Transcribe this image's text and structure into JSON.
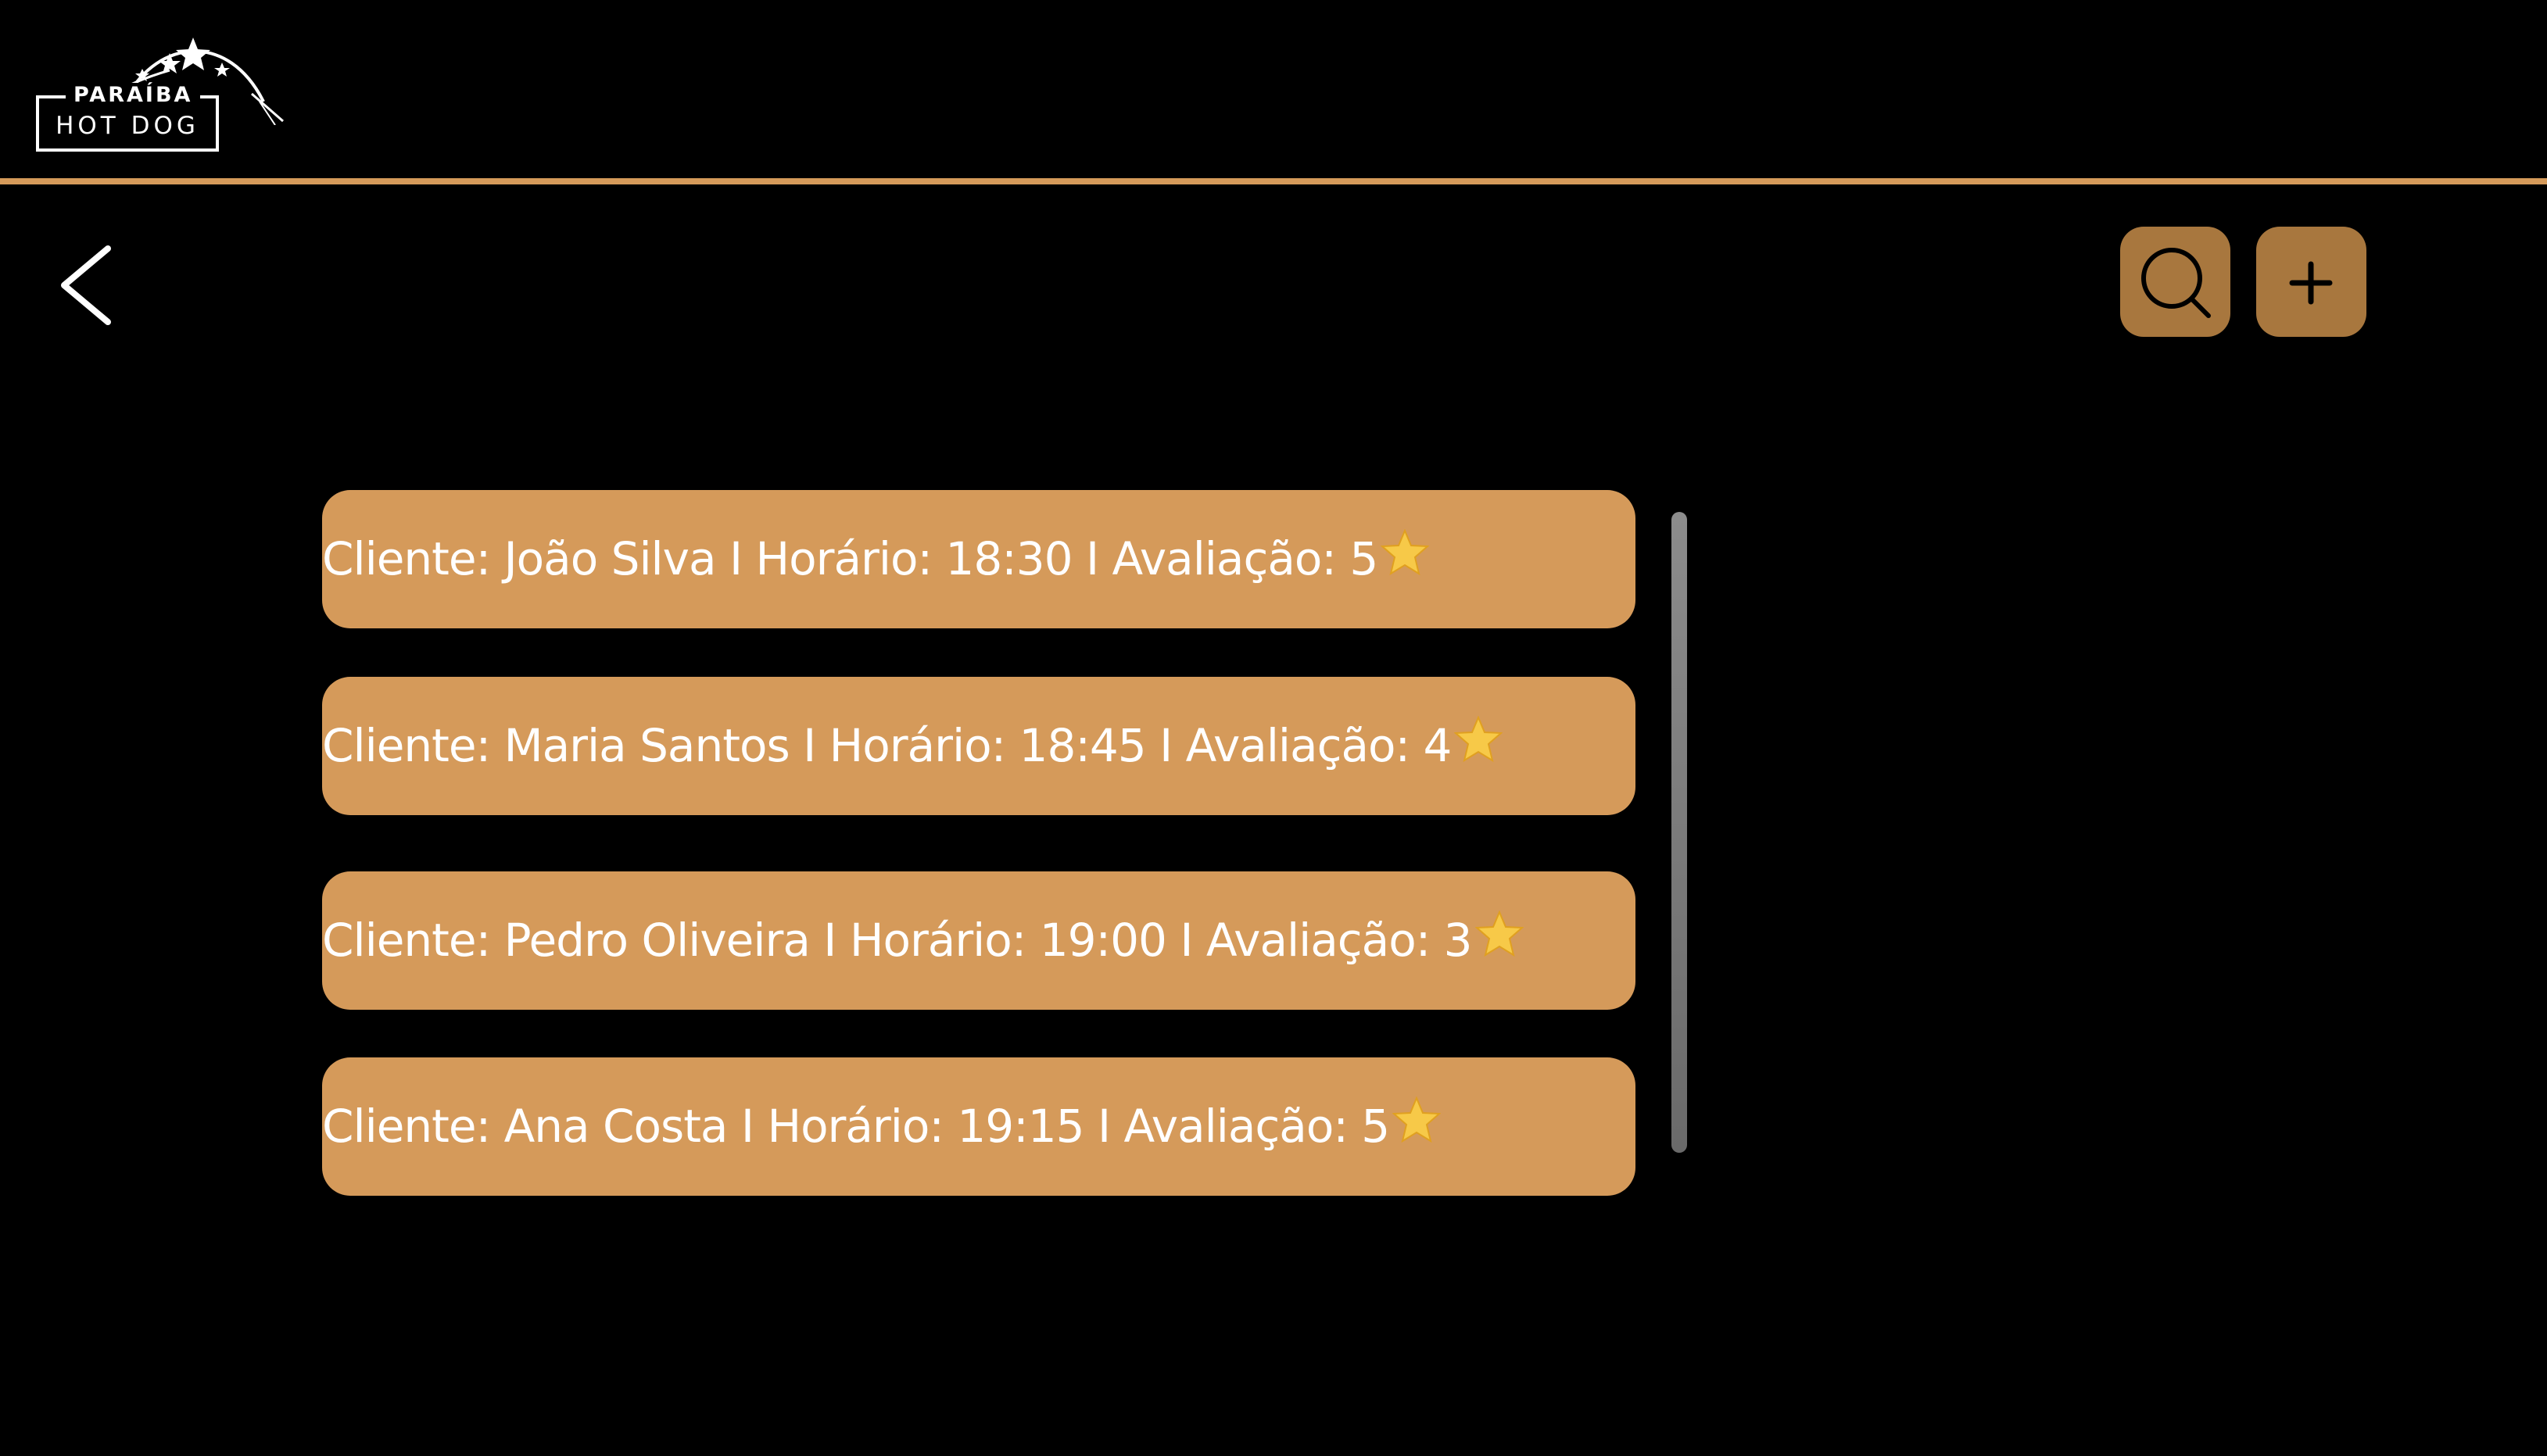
{
  "header": {
    "logo": {
      "top_text": "PARAÍBA",
      "bottom_text": "HOT DOG"
    },
    "divider_color": "#d59a5a"
  },
  "toolbar": {
    "back_icon": "chevron-left-icon",
    "search_icon": "search-icon",
    "add_icon": "plus-icon",
    "button_color": "#a8773e"
  },
  "orders": [
    {
      "text": "Cliente: João Silva I Horário: 18:30 I Avaliação: 5",
      "rating": 5
    },
    {
      "text": "Cliente: Maria Santos I Horário: 18:45 I Avaliação: 4",
      "rating": 4
    },
    {
      "text": "Cliente: Pedro Oliveira I Horário: 19:00 I Avaliação: 3",
      "rating": 3
    },
    {
      "text": "Cliente: Ana Costa I Horário: 19:15 I Avaliação: 5",
      "rating": 5
    }
  ],
  "colors": {
    "background": "#000000",
    "card": "#d59a5a",
    "text": "#ffffff",
    "star": "#f7c948"
  }
}
